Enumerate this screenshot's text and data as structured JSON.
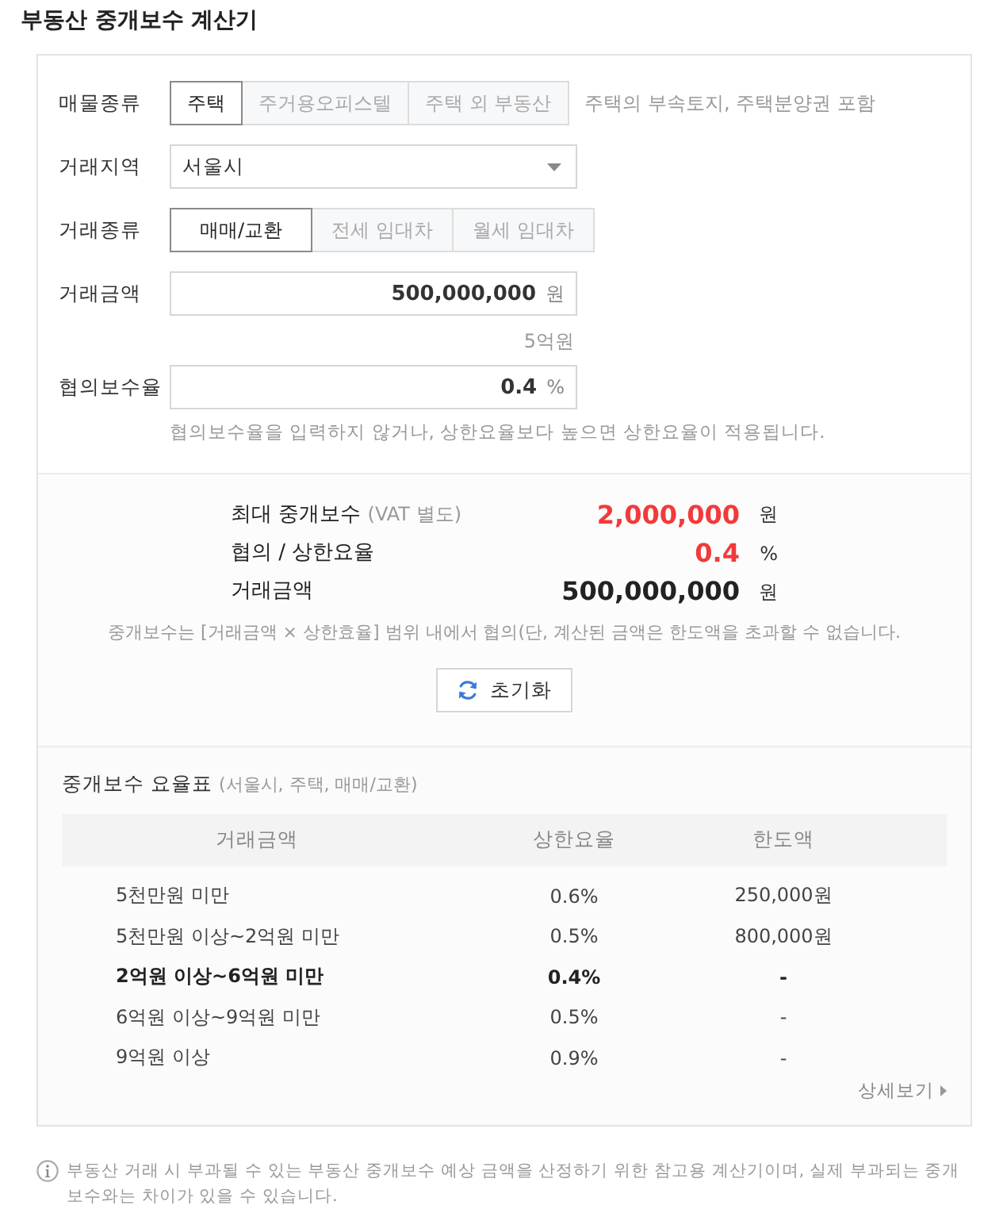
{
  "title": "부동산 중개보수 계산기",
  "form": {
    "fields": [
      {
        "kind": "segmented",
        "label": "매물종류",
        "options": [
          {
            "label": "주택",
            "selected": true
          },
          {
            "label": "주거용오피스텔",
            "selected": false
          },
          {
            "label": "주택 외 부동산",
            "selected": false
          }
        ],
        "note": "주택의 부속토지, 주택분양권 포함"
      },
      {
        "kind": "select",
        "label": "거래지역",
        "value": "서울시"
      },
      {
        "kind": "segmented",
        "label": "거래종류",
        "options": [
          {
            "label": "매매/교환",
            "selected": true
          },
          {
            "label": "전세 임대차",
            "selected": false
          },
          {
            "label": "월세 임대차",
            "selected": false
          }
        ]
      },
      {
        "kind": "number",
        "label": "거래금액",
        "value": "500,000,000",
        "unit": "원",
        "reading": "5억원"
      },
      {
        "kind": "number",
        "label": "협의보수율",
        "value": "0.4",
        "unit": "%",
        "hint": "협의보수율을 입력하지 않거나, 상한요율보다 높으면 상한요율이 적용됩니다."
      }
    ]
  },
  "result": {
    "rows": [
      {
        "label": "최대 중개보수",
        "note": "(VAT 별도)",
        "value": "2,000,000",
        "unit": "원",
        "emphasis": true
      },
      {
        "label": "협의 / 상한요율",
        "value": "0.4",
        "unit": "%",
        "emphasis": true
      },
      {
        "label": "거래금액",
        "value": "500,000,000",
        "unit": "원",
        "emphasis": false
      }
    ],
    "note": "중개보수는 [거래금액 × 상한효율] 범위 내에서 협의(단, 계산된 금액은 한도액을 초과할 수 없습니다.",
    "reset_button": "초기화"
  },
  "rate_table": {
    "title": "중개보수 요율표",
    "subtitle": "(서울시, 주택, 매매/교환)",
    "columns": [
      "거래금액",
      "상한요율",
      "한도액"
    ],
    "rows": [
      {
        "cells": [
          "5천만원 미만",
          "0.6%",
          "250,000원"
        ],
        "selected": false
      },
      {
        "cells": [
          "5천만원 이상~2억원 미만",
          "0.5%",
          "800,000원"
        ],
        "selected": false
      },
      {
        "cells": [
          "2억원 이상~6억원 미만",
          "0.4%",
          "-"
        ],
        "selected": true
      },
      {
        "cells": [
          "6억원 이상~9억원 미만",
          "0.5%",
          "-"
        ],
        "selected": false
      },
      {
        "cells": [
          "9억원 이상",
          "0.9%",
          "-"
        ],
        "selected": false
      }
    ],
    "more_link": "상세보기"
  },
  "footer_note": "부동산 거래 시 부과될 수 있는 부동산 중개보수 예상 금액을 산정하기 위한 참고용 계산기이며, 실제 부과되는 중개보수와는 차이가 있을 수 있습니다."
}
